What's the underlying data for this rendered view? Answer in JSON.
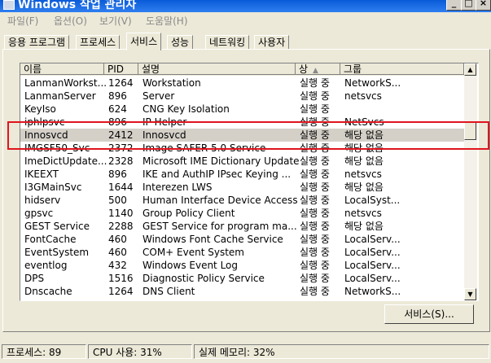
{
  "window": {
    "title": "Windows 작업 관리자"
  },
  "menu": [
    "파일(F)",
    "옵션(O)",
    "보기(V)",
    "도움말(H)"
  ],
  "tabs": [
    "응용 프로그램",
    "프로세스",
    "서비스",
    "성능",
    "네트워킹",
    "사용자"
  ],
  "active_tab": 2,
  "columns": [
    "이름",
    "PID",
    "설명",
    "상",
    "그룹"
  ],
  "rows": [
    {
      "name": "LanmanWorkst...",
      "pid": "1264",
      "desc": "Workstation",
      "status": "실행 중",
      "group": "NetworkS..."
    },
    {
      "name": "LanmanServer",
      "pid": "896",
      "desc": "Server",
      "status": "실행 중",
      "group": "netsvcs"
    },
    {
      "name": "KeyIso",
      "pid": "624",
      "desc": "CNG Key Isolation",
      "status": "실행 중",
      "group": ""
    },
    {
      "name": "iphlpsvc",
      "pid": "896",
      "desc": "IP Helper",
      "status": "실행 중",
      "group": "NetSvcs"
    },
    {
      "name": "Innosvcd",
      "pid": "2412",
      "desc": "Innosvcd",
      "status": "실행 중",
      "group": "해당 없음"
    },
    {
      "name": "IMGSF50_Svc",
      "pid": "2372",
      "desc": "Image SAFER 5.0 Service",
      "status": "실행 중",
      "group": "해당 없음"
    },
    {
      "name": "ImeDictUpdate...",
      "pid": "2328",
      "desc": "Microsoft IME Dictionary Update",
      "status": "실행 중",
      "group": "해당 없음"
    },
    {
      "name": "IKEEXT",
      "pid": "896",
      "desc": "IKE and AuthIP IPsec Keying ...",
      "status": "실행 중",
      "group": "netsvcs"
    },
    {
      "name": "I3GMainSvc",
      "pid": "1644",
      "desc": "Interezen LWS",
      "status": "실행 중",
      "group": "해당 없음"
    },
    {
      "name": "hidserv",
      "pid": "500",
      "desc": "Human Interface Device Access",
      "status": "실행 중",
      "group": "LocalSyst..."
    },
    {
      "name": "gpsvc",
      "pid": "1140",
      "desc": "Group Policy Client",
      "status": "실행 중",
      "group": "netsvcs"
    },
    {
      "name": "GEST Service",
      "pid": "2288",
      "desc": "GEST Service for program ma...",
      "status": "실행 중",
      "group": "해당 없음"
    },
    {
      "name": "FontCache",
      "pid": "460",
      "desc": "Windows Font Cache Service",
      "status": "실행 중",
      "group": "LocalServ..."
    },
    {
      "name": "EventSystem",
      "pid": "460",
      "desc": "COM+ Event System",
      "status": "실행 중",
      "group": "LocalServ..."
    },
    {
      "name": "eventlog",
      "pid": "432",
      "desc": "Windows Event Log",
      "status": "실행 중",
      "group": "LocalServ..."
    },
    {
      "name": "DPS",
      "pid": "1516",
      "desc": "Diagnostic Policy Service",
      "status": "실행 중",
      "group": "LocalServ..."
    },
    {
      "name": "Dnscache",
      "pid": "1264",
      "desc": "DNS Client",
      "status": "실행 중",
      "group": "NetworkS..."
    }
  ],
  "selected_row": 4,
  "services_button": "서비스(S)...",
  "status": {
    "processes": "프로세스: 89",
    "cpu": "CPU 사용: 31%",
    "memory": "실제 메모리: 32%"
  }
}
